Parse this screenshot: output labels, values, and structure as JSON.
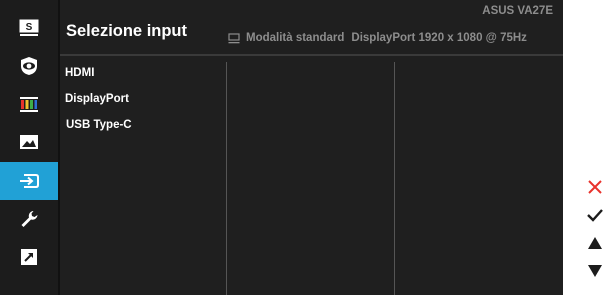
{
  "header": {
    "title": "Selezione input",
    "model": "ASUS  VA27E",
    "mode": "Modalità standard",
    "signal": "DisplayPort 1920 x 1080 @ 75Hz"
  },
  "sidebar": {
    "items": [
      {
        "name": "splendid-icon",
        "label": "S"
      },
      {
        "name": "eye-care-icon"
      },
      {
        "name": "color-icon"
      },
      {
        "name": "image-icon"
      },
      {
        "name": "input-select-icon",
        "active": true
      },
      {
        "name": "system-setup-icon"
      },
      {
        "name": "shortcut-icon"
      }
    ]
  },
  "inputs": {
    "options": [
      "HDMI",
      "DisplayPort",
      "USB Type-C"
    ]
  },
  "controls": {
    "buttons": [
      "close-icon",
      "confirm-icon",
      "up-arrow-icon",
      "down-arrow-icon"
    ]
  },
  "colors": {
    "accent": "#21a1d6",
    "close": "#e8322c",
    "background": "#1f1f1f",
    "muted_text": "#8d8d8d"
  }
}
